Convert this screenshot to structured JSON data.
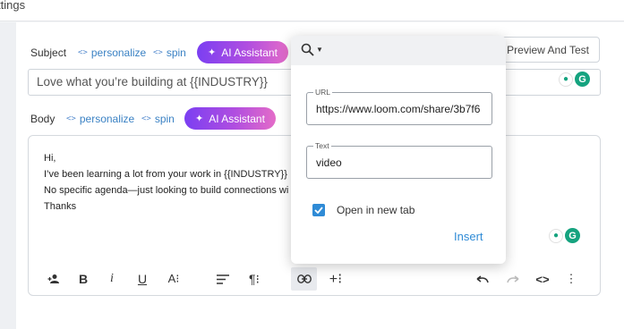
{
  "window": {
    "title": "ttings"
  },
  "subject": {
    "label": "Subject",
    "personalize": "personalize",
    "spin": "spin",
    "ai_assistant": "AI Assistant",
    "value": "Love what you’re building at {{INDUSTRY}}"
  },
  "preview_button": "Preview And Test",
  "body": {
    "label": "Body",
    "personalize": "personalize",
    "spin": "spin",
    "ai_assistant": "AI Assistant",
    "lines": [
      "Hi,",
      "I’ve been learning a lot from your work in {{INDUSTRY}}",
      "No specific agenda—just looking to build connections wi",
      "Thanks"
    ]
  },
  "toolbar": {
    "icons": [
      "person-add-icon",
      "bold-icon",
      "italic-icon",
      "underline-icon",
      "font-size-icon",
      "align-icon",
      "paragraph-icon",
      "link-icon",
      "insert-icon",
      "undo-icon",
      "redo-icon",
      "code-icon",
      "more-icon"
    ],
    "active": "link-icon"
  },
  "link_popup": {
    "url_label": "URL",
    "url_value": "https://www.loom.com/share/3b7f6",
    "text_label": "Text",
    "text_value": "video",
    "open_new_tab_label": "Open in new tab",
    "open_new_tab_checked": true,
    "insert_label": "Insert"
  },
  "colors": {
    "accent": "#2f8bd6",
    "ai_gradient_start": "#7b3ff2",
    "ai_gradient_end": "#e46cc8",
    "grammarly": "#15a37f"
  }
}
